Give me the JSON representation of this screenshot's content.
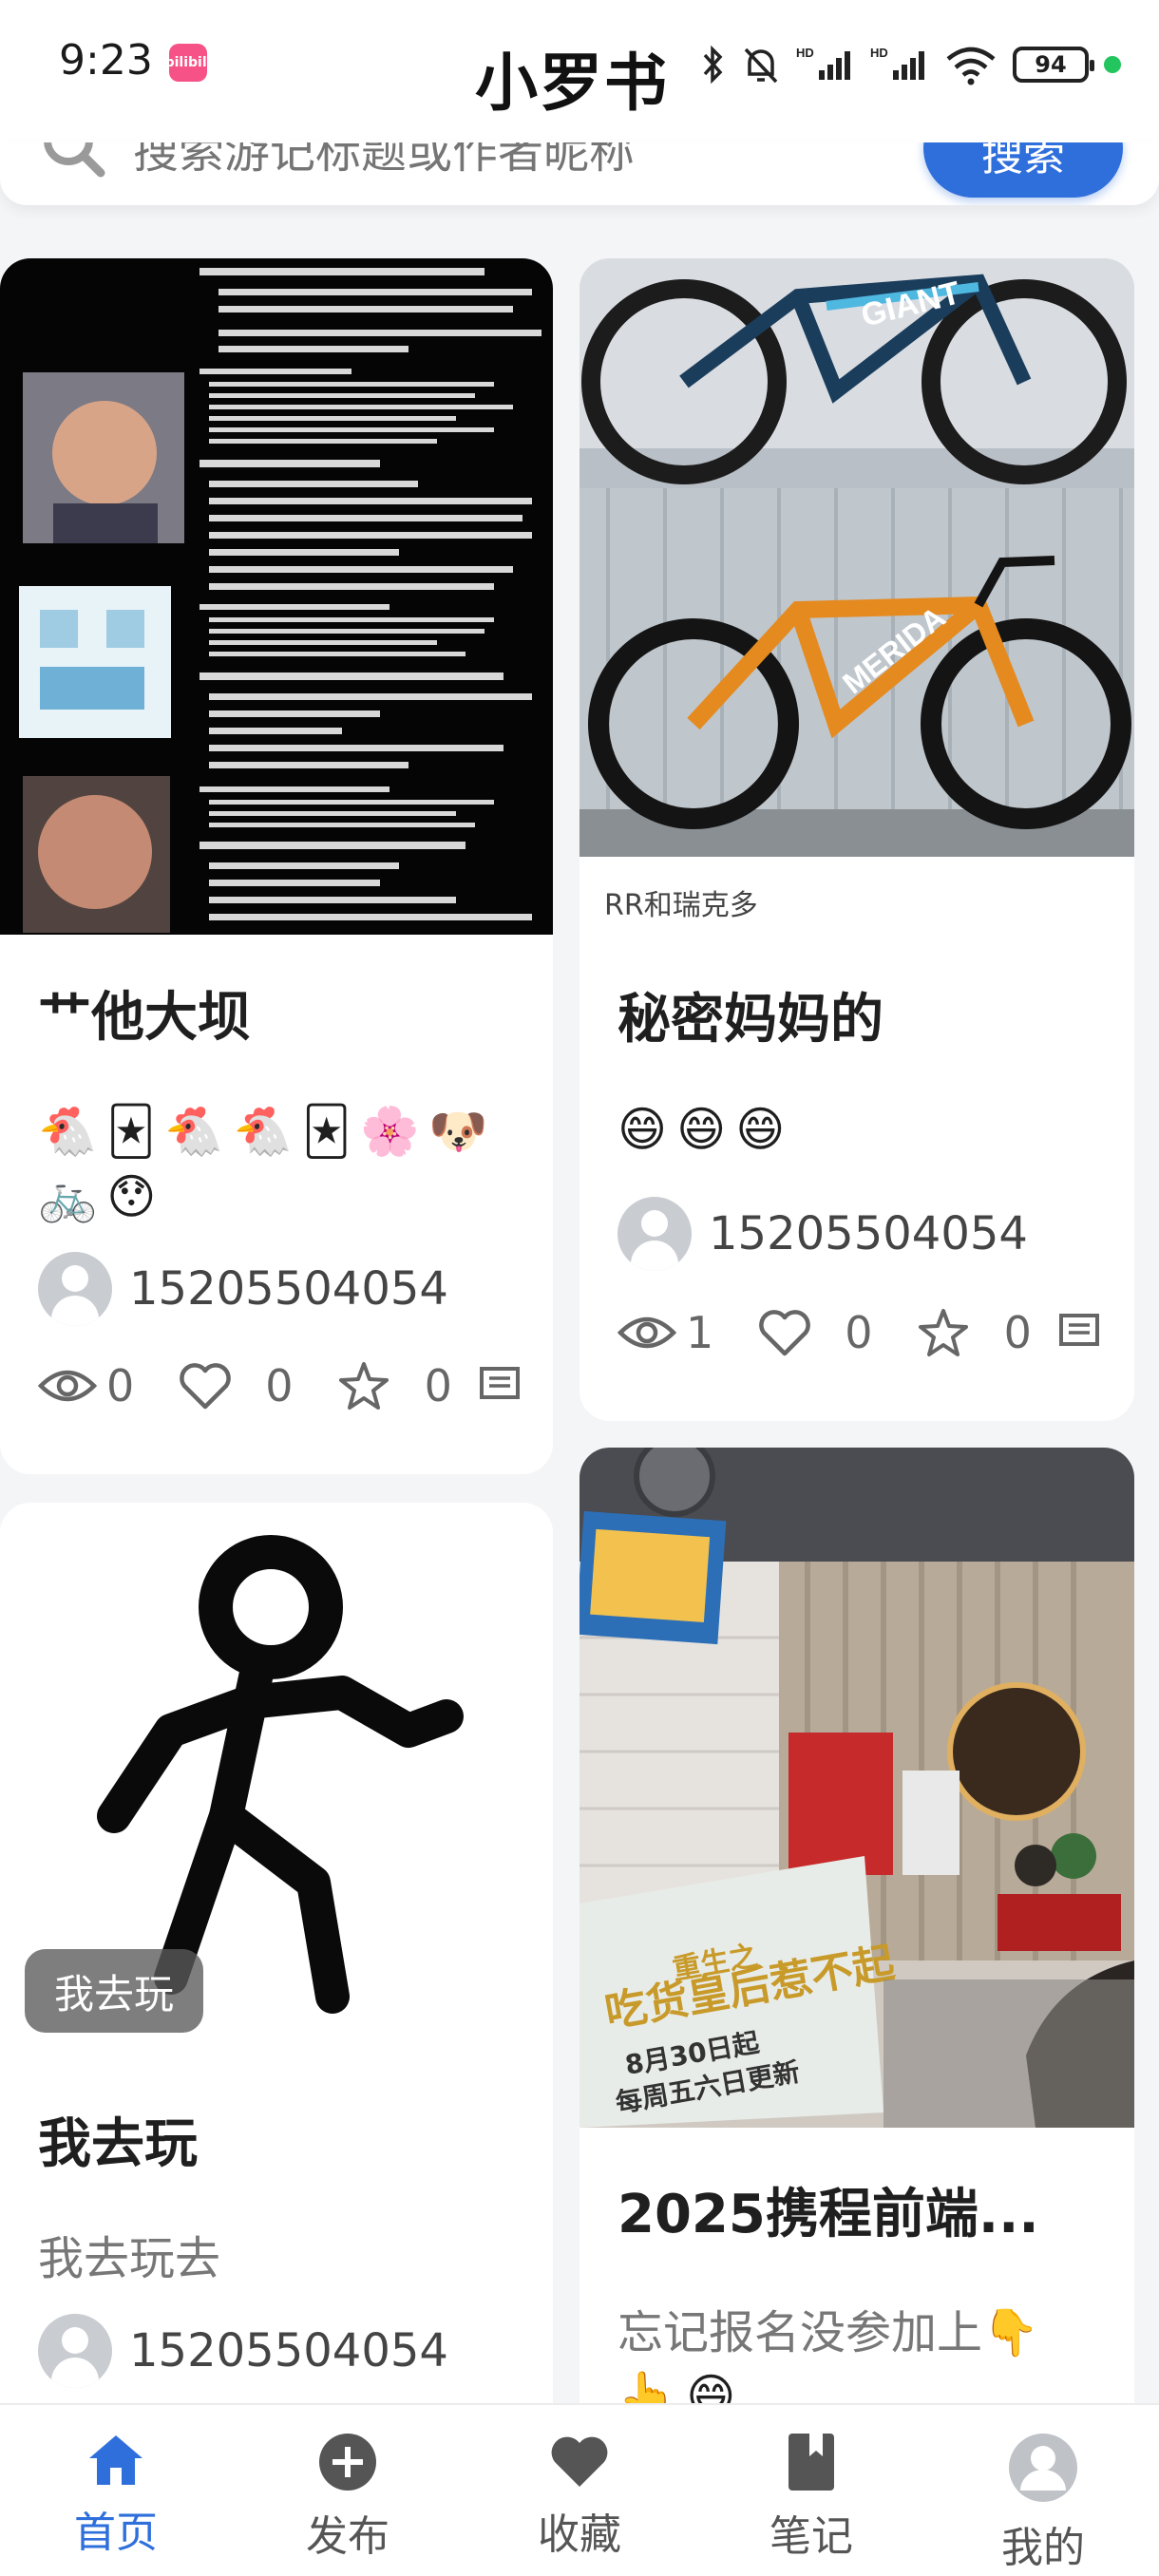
{
  "status_bar": {
    "time": "9:23",
    "app_icon_text": "bilibili",
    "title": "小罗书",
    "battery": "94"
  },
  "search": {
    "placeholder": "搜索游记标题或作者昵称",
    "button_label": "搜索"
  },
  "cards": [
    {
      "title": "艹他大坝",
      "emojis": [
        "🐔",
        "🃏",
        "🐔",
        "🐔",
        "🃏",
        "🌸",
        "🐶",
        "🚲",
        "😯"
      ],
      "author": "15205504054",
      "views": "0",
      "likes": "0",
      "stars": "0",
      "image_subject": "hacker list collage"
    },
    {
      "title": "秘密妈妈的",
      "emojis": [
        "😄",
        "😄",
        "😄"
      ],
      "author": "15205504054",
      "views": "1",
      "likes": "0",
      "stars": "0",
      "image_caption": "RR和瑞克多",
      "image_subject": "road bikes GIANT and MERIDA",
      "bike_brands": [
        "GIANT",
        "MERIDA"
      ]
    },
    {
      "title": "我去玩",
      "desc": "我去玩去",
      "tag": "我去玩",
      "author": "15205504054",
      "image_subject": "running stick figure"
    },
    {
      "title": "2025携程前端...",
      "desc": "忘记报名没参加上👇",
      "emojis": [
        "👆",
        "😄"
      ],
      "image_subject": "KFC store interior",
      "store_sign_text": [
        "重生之",
        "吃货皇后惹不起",
        "8月30日起",
        "每周五六日更新"
      ]
    }
  ],
  "nav": [
    {
      "label": "首页",
      "icon": "home-icon",
      "active": true
    },
    {
      "label": "发布",
      "icon": "plus-circle-icon",
      "active": false
    },
    {
      "label": "收藏",
      "icon": "heart-icon",
      "active": false
    },
    {
      "label": "笔记",
      "icon": "notebook-icon",
      "active": false
    },
    {
      "label": "我的",
      "icon": "user-icon",
      "active": false
    }
  ],
  "colors": {
    "accent": "#2f6fdc",
    "background": "#f4f5f7"
  }
}
